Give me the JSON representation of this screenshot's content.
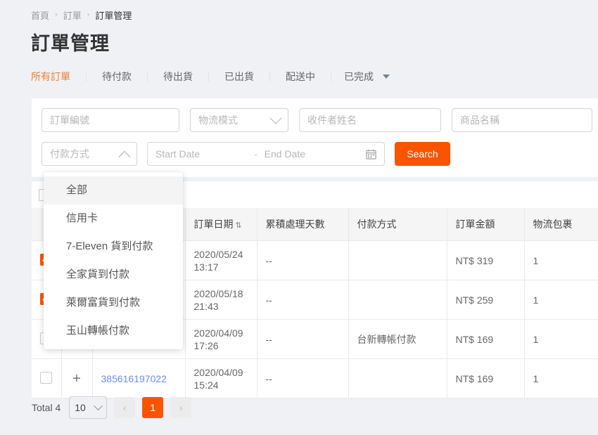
{
  "breadcrumb": {
    "items": [
      {
        "label": "首頁"
      },
      {
        "label": "訂單"
      },
      {
        "label": "訂單管理"
      }
    ],
    "separator": "›"
  },
  "page_title": "訂單管理",
  "tabs": {
    "items": [
      {
        "label": "所有訂單",
        "active": true
      },
      {
        "label": "待付款",
        "active": false
      },
      {
        "label": "待出貨",
        "active": false
      },
      {
        "label": "已出貨",
        "active": false
      },
      {
        "label": "配送中",
        "active": false
      },
      {
        "label": "已完成",
        "active": false
      }
    ]
  },
  "filters": {
    "order_no_placeholder": "訂單編號",
    "logistics_placeholder": "物流模式",
    "receiver_placeholder": "收件者姓名",
    "product_placeholder": "商品名稱",
    "payment_placeholder": "付款方式",
    "start_date_placeholder": "Start Date",
    "date_separator": "-",
    "end_date_placeholder": "End Date",
    "search_label": "Search"
  },
  "payment_dropdown": {
    "open": true,
    "options": [
      {
        "label": "全部",
        "selected": true
      },
      {
        "label": "信用卡",
        "selected": false
      },
      {
        "label": "7-Eleven 貨到付款",
        "selected": false
      },
      {
        "label": "全家貨到付款",
        "selected": false
      },
      {
        "label": "萊爾富貨到付款",
        "selected": false
      },
      {
        "label": "玉山轉帳付款",
        "selected": false
      }
    ]
  },
  "table": {
    "columns": [
      {
        "key": "check",
        "label": ""
      },
      {
        "key": "expand",
        "label": ""
      },
      {
        "key": "order_no",
        "label": ""
      },
      {
        "key": "order_date",
        "label": "訂單日期",
        "sort_icon": "⇅"
      },
      {
        "key": "processing_days",
        "label": "累積處理天數"
      },
      {
        "key": "payment_method",
        "label": "付款方式"
      },
      {
        "key": "order_amount",
        "label": "訂單金額"
      },
      {
        "key": "parcel",
        "label": "物流包裹"
      }
    ],
    "select_all_checked": false,
    "rows": [
      {
        "checked": true,
        "expand": "+",
        "order_no": "",
        "order_date": "2020/05/24",
        "order_time": "13:17",
        "processing_days": "--",
        "payment_method": "",
        "order_amount": "NT$ 319",
        "parcel": "1"
      },
      {
        "checked": true,
        "expand": "+",
        "order_no": "",
        "order_date": "2020/05/18",
        "order_time": "21:43",
        "processing_days": "--",
        "payment_method": "",
        "order_amount": "NT$ 259",
        "parcel": "1"
      },
      {
        "checked": false,
        "expand": "+",
        "order_no": "",
        "order_date": "2020/04/09",
        "order_time": "17:26",
        "processing_days": "--",
        "payment_method": "台新轉帳付款",
        "order_amount": "NT$ 169",
        "parcel": "1"
      },
      {
        "checked": false,
        "expand": "+",
        "order_no": "385616197022",
        "order_date": "2020/04/09",
        "order_time": "15:24",
        "processing_days": "--",
        "payment_method": "",
        "order_amount": "NT$ 169",
        "parcel": "1"
      }
    ]
  },
  "pagination": {
    "total_label": "Total 4",
    "page_size": "10",
    "prev_label": "‹",
    "next_label": "›",
    "current_page": "1"
  },
  "colors": {
    "brand_orange": "#fa5400",
    "tab_active": "#ee7e34",
    "link_blue": "#6c8fe8",
    "page_bg": "#eff1f5"
  }
}
